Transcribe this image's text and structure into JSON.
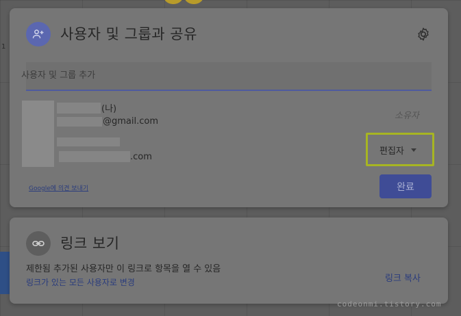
{
  "share_dialog": {
    "title": "사용자 및 그룹과 공유",
    "add_people_placeholder": "사용자 및 그룹 추가",
    "members": [
      {
        "name_suffix": "(나)",
        "email_suffix": "@gmail.com",
        "role": "소유자"
      },
      {
        "email_suffix": ".com",
        "role": "편집자"
      }
    ],
    "feedback_link": "Google에 의견 보내기",
    "done_button": "완료",
    "icons": {
      "share": "person-add-icon",
      "settings": "gear-icon",
      "dropdown": "caret-down-icon"
    },
    "colors": {
      "accent": "#3f4c96",
      "highlight": "#a7b522"
    }
  },
  "link_card": {
    "title": "링크 보기",
    "description": "제한됨 추가된 사용자만 이 링크로 항목을 열 수 있음",
    "change_link": "링크가 있는 모든 사용자로 변경",
    "copy_link": "링크 복사",
    "icons": {
      "link": "link-icon"
    }
  },
  "watermark": "codeonmi.tistory.com"
}
